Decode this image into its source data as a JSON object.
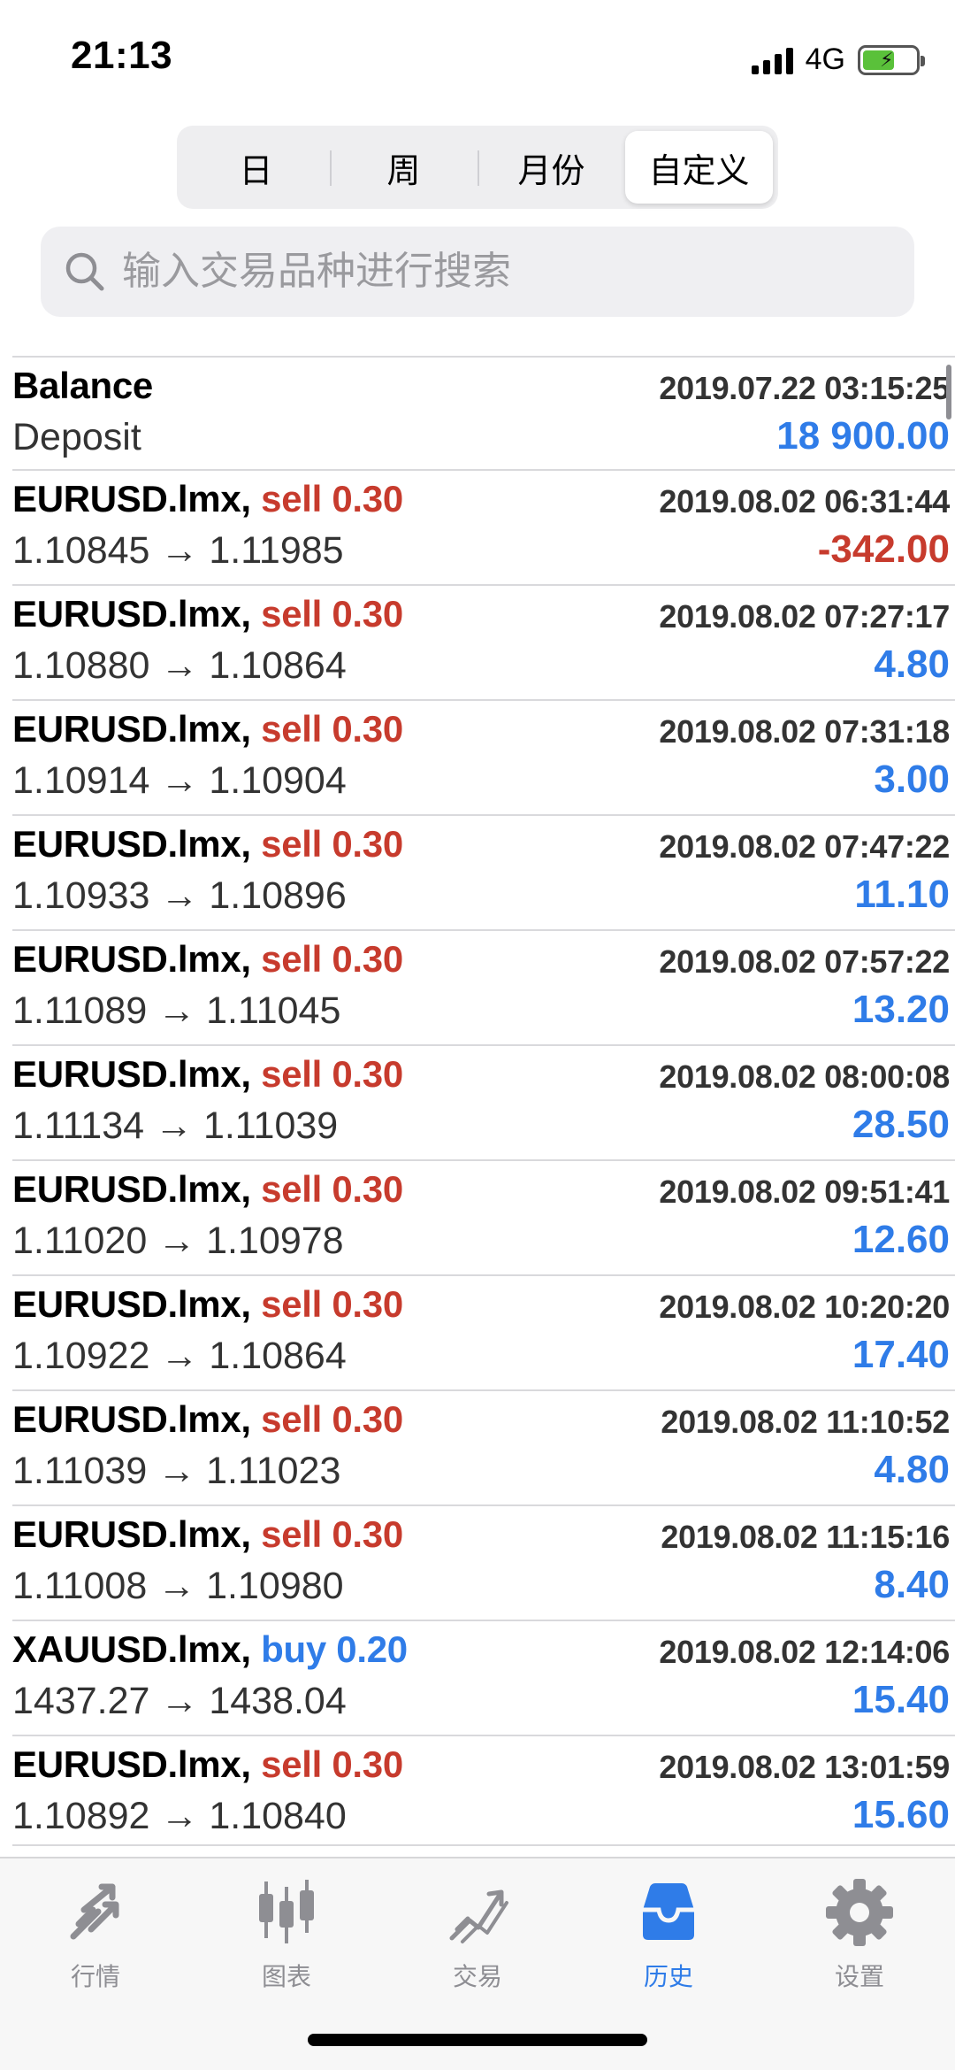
{
  "status": {
    "time": "21:13",
    "network": "4G"
  },
  "segmented": [
    "日",
    "周",
    "月份",
    "自定义"
  ],
  "search": {
    "placeholder": "输入交易品种进行搜索"
  },
  "deals": [
    {
      "title": "Balance",
      "sub": "Deposit",
      "date": "2019.07.22 03:15:25",
      "amount": "18 900.00",
      "sign": "pos",
      "type": "balance"
    },
    {
      "symbol": "EURUSD.lmx,",
      "side": "sell 0.30",
      "dir": "sell",
      "sub": "1.10845 → 1.11985",
      "date": "2019.08.02 06:31:44",
      "amount": "-342.00",
      "sign": "neg"
    },
    {
      "symbol": "EURUSD.lmx,",
      "side": "sell 0.30",
      "dir": "sell",
      "sub": "1.10880 → 1.10864",
      "date": "2019.08.02 07:27:17",
      "amount": "4.80",
      "sign": "pos"
    },
    {
      "symbol": "EURUSD.lmx,",
      "side": "sell 0.30",
      "dir": "sell",
      "sub": "1.10914 → 1.10904",
      "date": "2019.08.02 07:31:18",
      "amount": "3.00",
      "sign": "pos"
    },
    {
      "symbol": "EURUSD.lmx,",
      "side": "sell 0.30",
      "dir": "sell",
      "sub": "1.10933 → 1.10896",
      "date": "2019.08.02 07:47:22",
      "amount": "11.10",
      "sign": "pos"
    },
    {
      "symbol": "EURUSD.lmx,",
      "side": "sell 0.30",
      "dir": "sell",
      "sub": "1.11089 → 1.11045",
      "date": "2019.08.02 07:57:22",
      "amount": "13.20",
      "sign": "pos"
    },
    {
      "symbol": "EURUSD.lmx,",
      "side": "sell 0.30",
      "dir": "sell",
      "sub": "1.11134 → 1.11039",
      "date": "2019.08.02 08:00:08",
      "amount": "28.50",
      "sign": "pos"
    },
    {
      "symbol": "EURUSD.lmx,",
      "side": "sell 0.30",
      "dir": "sell",
      "sub": "1.11020 → 1.10978",
      "date": "2019.08.02 09:51:41",
      "amount": "12.60",
      "sign": "pos"
    },
    {
      "symbol": "EURUSD.lmx,",
      "side": "sell 0.30",
      "dir": "sell",
      "sub": "1.10922 → 1.10864",
      "date": "2019.08.02 10:20:20",
      "amount": "17.40",
      "sign": "pos"
    },
    {
      "symbol": "EURUSD.lmx,",
      "side": "sell 0.30",
      "dir": "sell",
      "sub": "1.11039 → 1.11023",
      "date": "2019.08.02 11:10:52",
      "amount": "4.80",
      "sign": "pos"
    },
    {
      "symbol": "EURUSD.lmx,",
      "side": "sell 0.30",
      "dir": "sell",
      "sub": "1.11008 → 1.10980",
      "date": "2019.08.02 11:15:16",
      "amount": "8.40",
      "sign": "pos"
    },
    {
      "symbol": "XAUUSD.lmx,",
      "side": "buy 0.20",
      "dir": "buy",
      "sub": "1437.27 → 1438.04",
      "date": "2019.08.02 12:14:06",
      "amount": "15.40",
      "sign": "pos"
    },
    {
      "symbol": "EURUSD.lmx,",
      "side": "sell 0.30",
      "dir": "sell",
      "sub": "1.10892 → 1.10840",
      "date": "2019.08.02 13:01:59",
      "amount": "15.60",
      "sign": "pos"
    }
  ],
  "tabs": [
    {
      "label": "行情",
      "icon": "quotes-icon"
    },
    {
      "label": "图表",
      "icon": "chart-icon"
    },
    {
      "label": "交易",
      "icon": "trade-icon"
    },
    {
      "label": "历史",
      "icon": "history-icon",
      "active": true
    },
    {
      "label": "设置",
      "icon": "settings-icon"
    }
  ],
  "colors": {
    "accent": "#2f7ce8",
    "negative": "#c73b2d",
    "inactive_tab": "#8e8e93"
  }
}
